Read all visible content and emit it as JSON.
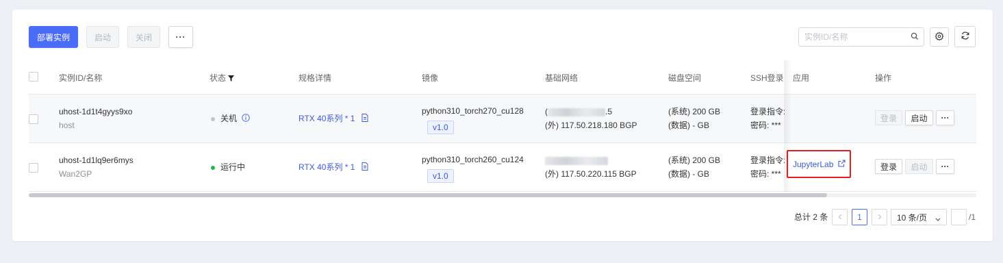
{
  "toolbar": {
    "deploy_label": "部署实例",
    "start_label": "启动",
    "shutdown_label": "关闭",
    "more_label": "···"
  },
  "search": {
    "placeholder": "实例ID/名称"
  },
  "columns": {
    "id_name": "实例ID/名称",
    "status": "状态",
    "spec": "规格详情",
    "image": "镜像",
    "network": "基础网络",
    "disk": "磁盘空间",
    "ssh": "SSH登录",
    "app": "应用",
    "ops": "操作"
  },
  "rows": [
    {
      "id": "uhost-1d1t4gyys9xo",
      "name": "host",
      "status": "关机",
      "status_color": "#c0c4cc",
      "spec": "RTX 40系列 * 1",
      "image": "python310_torch270_cu128",
      "image_version": "v1.0",
      "net_inner_prefix": "(",
      "net_inner_suffix": ".5",
      "net_outer": "(外) 117.50.218.180 BGP",
      "disk_sys": "(系统) 200 GB",
      "disk_data": "(数据) - GB",
      "ssh_cmd": "登录指令:",
      "ssh_pwd": "密码:  ***",
      "app": "",
      "op_login": "登录",
      "op_start": "启动",
      "op_more": "···"
    },
    {
      "id": "uhost-1d1lq9er6mys",
      "name": "Wan2GP",
      "status": "运行中",
      "status_color": "#2bb24c",
      "spec": "RTX 40系列 * 1",
      "image": "python310_torch260_cu124",
      "image_version": "v1.0",
      "net_inner_prefix": "",
      "net_inner_suffix": "",
      "net_outer": "(外) 117.50.220.115 BGP",
      "disk_sys": "(系统) 200 GB",
      "disk_data": "(数据) - GB",
      "ssh_cmd": "登录指令:",
      "ssh_pwd": "密码:  ***",
      "app": "JupyterLab",
      "op_login": "登录",
      "op_start": "启动",
      "op_more": "···"
    }
  ],
  "pagination": {
    "total": "总计 2 条",
    "current_page": "1",
    "page_size": "10 条/页",
    "jump_value": "",
    "total_pages": "/1"
  },
  "colors": {
    "primary": "#4a6cf7",
    "link": "#3b5bdb",
    "highlight": "#e02020"
  }
}
